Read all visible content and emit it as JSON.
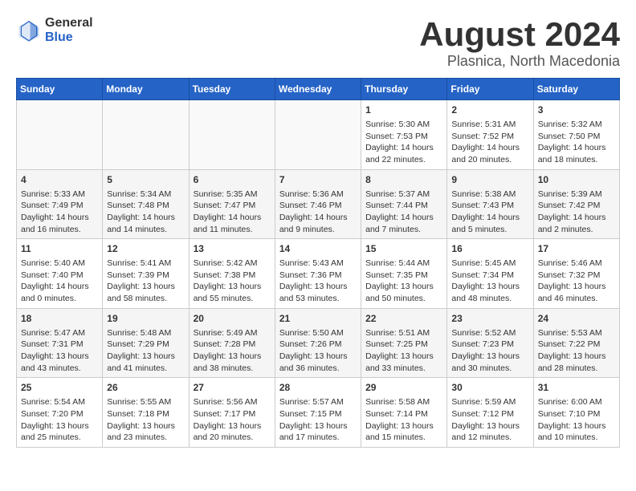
{
  "header": {
    "logo_general": "General",
    "logo_blue": "Blue",
    "main_title": "August 2024",
    "subtitle": "Plasnica, North Macedonia"
  },
  "calendar": {
    "days_of_week": [
      "Sunday",
      "Monday",
      "Tuesday",
      "Wednesday",
      "Thursday",
      "Friday",
      "Saturday"
    ],
    "weeks": [
      [
        {
          "day": "",
          "content": ""
        },
        {
          "day": "",
          "content": ""
        },
        {
          "day": "",
          "content": ""
        },
        {
          "day": "",
          "content": ""
        },
        {
          "day": "1",
          "content": "Sunrise: 5:30 AM\nSunset: 7:53 PM\nDaylight: 14 hours\nand 22 minutes."
        },
        {
          "day": "2",
          "content": "Sunrise: 5:31 AM\nSunset: 7:52 PM\nDaylight: 14 hours\nand 20 minutes."
        },
        {
          "day": "3",
          "content": "Sunrise: 5:32 AM\nSunset: 7:50 PM\nDaylight: 14 hours\nand 18 minutes."
        }
      ],
      [
        {
          "day": "4",
          "content": "Sunrise: 5:33 AM\nSunset: 7:49 PM\nDaylight: 14 hours\nand 16 minutes."
        },
        {
          "day": "5",
          "content": "Sunrise: 5:34 AM\nSunset: 7:48 PM\nDaylight: 14 hours\nand 14 minutes."
        },
        {
          "day": "6",
          "content": "Sunrise: 5:35 AM\nSunset: 7:47 PM\nDaylight: 14 hours\nand 11 minutes."
        },
        {
          "day": "7",
          "content": "Sunrise: 5:36 AM\nSunset: 7:46 PM\nDaylight: 14 hours\nand 9 minutes."
        },
        {
          "day": "8",
          "content": "Sunrise: 5:37 AM\nSunset: 7:44 PM\nDaylight: 14 hours\nand 7 minutes."
        },
        {
          "day": "9",
          "content": "Sunrise: 5:38 AM\nSunset: 7:43 PM\nDaylight: 14 hours\nand 5 minutes."
        },
        {
          "day": "10",
          "content": "Sunrise: 5:39 AM\nSunset: 7:42 PM\nDaylight: 14 hours\nand 2 minutes."
        }
      ],
      [
        {
          "day": "11",
          "content": "Sunrise: 5:40 AM\nSunset: 7:40 PM\nDaylight: 14 hours\nand 0 minutes."
        },
        {
          "day": "12",
          "content": "Sunrise: 5:41 AM\nSunset: 7:39 PM\nDaylight: 13 hours\nand 58 minutes."
        },
        {
          "day": "13",
          "content": "Sunrise: 5:42 AM\nSunset: 7:38 PM\nDaylight: 13 hours\nand 55 minutes."
        },
        {
          "day": "14",
          "content": "Sunrise: 5:43 AM\nSunset: 7:36 PM\nDaylight: 13 hours\nand 53 minutes."
        },
        {
          "day": "15",
          "content": "Sunrise: 5:44 AM\nSunset: 7:35 PM\nDaylight: 13 hours\nand 50 minutes."
        },
        {
          "day": "16",
          "content": "Sunrise: 5:45 AM\nSunset: 7:34 PM\nDaylight: 13 hours\nand 48 minutes."
        },
        {
          "day": "17",
          "content": "Sunrise: 5:46 AM\nSunset: 7:32 PM\nDaylight: 13 hours\nand 46 minutes."
        }
      ],
      [
        {
          "day": "18",
          "content": "Sunrise: 5:47 AM\nSunset: 7:31 PM\nDaylight: 13 hours\nand 43 minutes."
        },
        {
          "day": "19",
          "content": "Sunrise: 5:48 AM\nSunset: 7:29 PM\nDaylight: 13 hours\nand 41 minutes."
        },
        {
          "day": "20",
          "content": "Sunrise: 5:49 AM\nSunset: 7:28 PM\nDaylight: 13 hours\nand 38 minutes."
        },
        {
          "day": "21",
          "content": "Sunrise: 5:50 AM\nSunset: 7:26 PM\nDaylight: 13 hours\nand 36 minutes."
        },
        {
          "day": "22",
          "content": "Sunrise: 5:51 AM\nSunset: 7:25 PM\nDaylight: 13 hours\nand 33 minutes."
        },
        {
          "day": "23",
          "content": "Sunrise: 5:52 AM\nSunset: 7:23 PM\nDaylight: 13 hours\nand 30 minutes."
        },
        {
          "day": "24",
          "content": "Sunrise: 5:53 AM\nSunset: 7:22 PM\nDaylight: 13 hours\nand 28 minutes."
        }
      ],
      [
        {
          "day": "25",
          "content": "Sunrise: 5:54 AM\nSunset: 7:20 PM\nDaylight: 13 hours\nand 25 minutes."
        },
        {
          "day": "26",
          "content": "Sunrise: 5:55 AM\nSunset: 7:18 PM\nDaylight: 13 hours\nand 23 minutes."
        },
        {
          "day": "27",
          "content": "Sunrise: 5:56 AM\nSunset: 7:17 PM\nDaylight: 13 hours\nand 20 minutes."
        },
        {
          "day": "28",
          "content": "Sunrise: 5:57 AM\nSunset: 7:15 PM\nDaylight: 13 hours\nand 17 minutes."
        },
        {
          "day": "29",
          "content": "Sunrise: 5:58 AM\nSunset: 7:14 PM\nDaylight: 13 hours\nand 15 minutes."
        },
        {
          "day": "30",
          "content": "Sunrise: 5:59 AM\nSunset: 7:12 PM\nDaylight: 13 hours\nand 12 minutes."
        },
        {
          "day": "31",
          "content": "Sunrise: 6:00 AM\nSunset: 7:10 PM\nDaylight: 13 hours\nand 10 minutes."
        }
      ]
    ]
  }
}
